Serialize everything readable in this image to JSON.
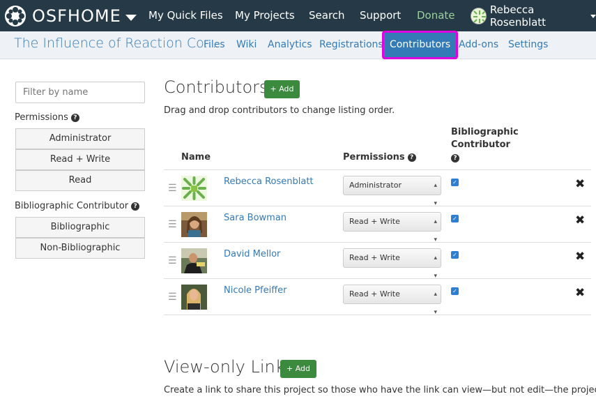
{
  "topbar": {
    "brand": "OSFHOME",
    "nav": [
      "My Quick Files",
      "My Projects",
      "Search",
      "Support",
      "Donate"
    ],
    "user": "Rebecca Rosenblatt"
  },
  "project": {
    "title": "The Influence of Reaction Co...",
    "nav": [
      "Files",
      "Wiki",
      "Analytics",
      "Registrations",
      "Contributors",
      "Add-ons",
      "Settings"
    ],
    "active": "Contributors"
  },
  "sidebar": {
    "filter_placeholder": "Filter by name",
    "permissions_label": "Permissions",
    "permissions": [
      "Administrator",
      "Read + Write",
      "Read"
    ],
    "biblio_label": "Bibliographic Contributor",
    "biblio": [
      "Bibliographic",
      "Non-Bibliographic"
    ]
  },
  "contributors": {
    "title": "Contributors",
    "add_label": "+ Add",
    "instructions": "Drag and drop contributors to change listing order.",
    "col_name": "Name",
    "col_permissions": "Permissions",
    "col_biblio_line1": "Bibliographic",
    "col_biblio_line2": "Contributor",
    "rows": [
      {
        "name": "Rebecca Rosenblatt",
        "permission": "Administrator",
        "bibliographic": true
      },
      {
        "name": "Sara Bowman",
        "permission": "Read + Write",
        "bibliographic": true
      },
      {
        "name": "David Mellor",
        "permission": "Read + Write",
        "bibliographic": true
      },
      {
        "name": "Nicole Pfeiffer",
        "permission": "Read + Write",
        "bibliographic": true
      }
    ]
  },
  "view_only": {
    "title": "View-only Links",
    "add_label": "+ Add",
    "description": "Create a link to share this project so those who have the link can view—but not edit—the project."
  },
  "colors": {
    "topbar": "#263947",
    "link": "#337ab7",
    "add_button": "#3b8a3e",
    "highlight": "#e000e0"
  }
}
